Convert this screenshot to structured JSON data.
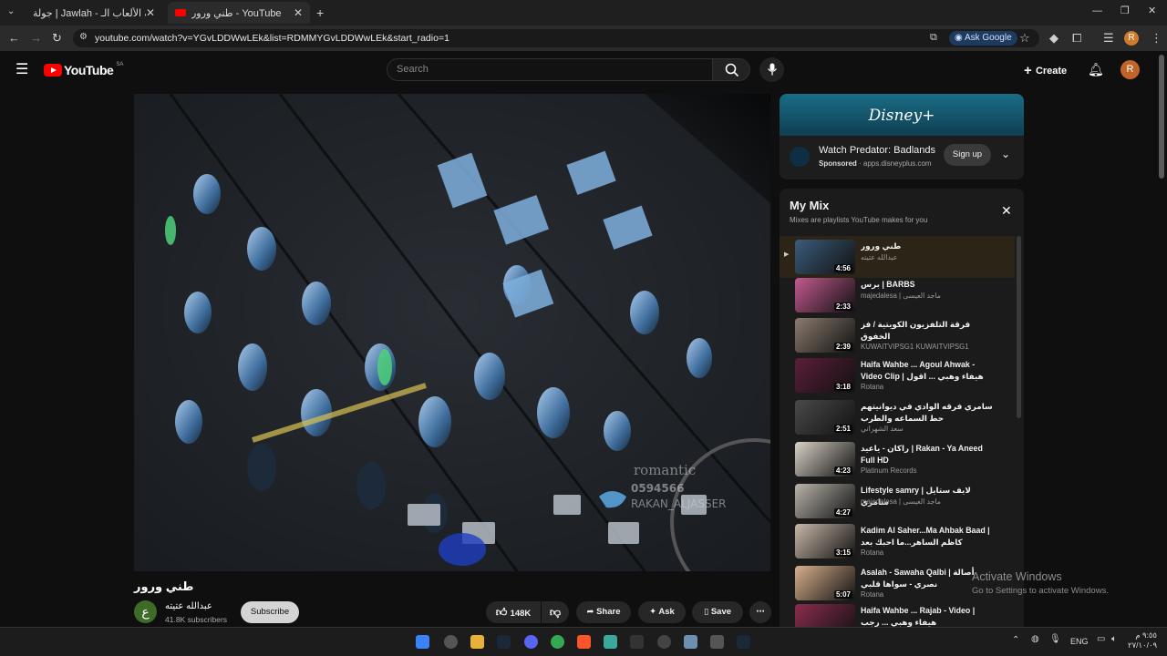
{
  "browser": {
    "tabs": [
      {
        "label": "جولة | Jawlah - منصة الألعاب الـ..."
      },
      {
        "label": "طني ورور - YouTube"
      }
    ],
    "url": "youtube.com/watch?v=YGvLDDWwLEk&list=RDMMYGvLDDWwLEk&start_radio=1",
    "ask_google": "Ask Google",
    "profile_initial": "R"
  },
  "youtube": {
    "logo_text": "YouTube",
    "country_code": "SA",
    "search_placeholder": "Search",
    "create_label": "Create",
    "avatar_initial": "R"
  },
  "video": {
    "overlay_lines": [
      "romantic",
      "0594566",
      "RAKAN_ALJASSER"
    ],
    "title": "طني ورور",
    "channel_initial": "ع",
    "channel_name": "عبدالله عتيته",
    "subscribers": "41.8K subscribers",
    "subscribe_label": "Subscribe",
    "likes": "148K",
    "share_label": "Share",
    "ask_label": "Ask",
    "save_label": "Save"
  },
  "ad": {
    "brand": "Disney+",
    "title": "Watch Predator: Badlands",
    "sponsored": "Sponsored",
    "domain": "apps.disneyplus.com",
    "cta": "Sign up"
  },
  "mix": {
    "title": "My Mix",
    "subtitle": "Mixes are playlists YouTube makes for you",
    "items": [
      {
        "title": "طني ورور",
        "channel": "عبدالله عتيته",
        "duration": "4:56",
        "thumb": "#3b5c7a"
      },
      {
        "title": "برس | BARBS",
        "channel": "majedalesa | ماجد العيسى",
        "duration": "2:33",
        "thumb": "#c25a8e"
      },
      {
        "title": "فرقة التلفزيون الكويتية / فز الخفوق",
        "channel": "KUWAITVIPSG1 KUWAITVIPSG1",
        "duration": "2:39",
        "thumb": "#8a7b6e"
      },
      {
        "title": "Haifa Wahbe ... Agoul Ahwak - Video Clip | هيفاء وهبي ... اقول اهواك",
        "channel": "Rotana",
        "duration": "3:18",
        "thumb": "#5c1e3a"
      },
      {
        "title": "سامري فرقه الوادي في ديوانيتهم حط السماعه والطرب",
        "channel": "سعد الشهراني",
        "duration": "2:51",
        "thumb": "#4a4a4a"
      },
      {
        "title": "راكان - ياعيد | Rakan - Ya Aneed Full HD",
        "channel": "Platinum Records",
        "duration": "4:23",
        "thumb": "#d9d2c6"
      },
      {
        "title": "Lifestyle samry | لايف ستايل سامري",
        "channel": "majedalesa | ماجد العيسى",
        "duration": "4:27",
        "thumb": "#b9b4ab"
      },
      {
        "title": "Kadim Al Saher...Ma Ahbak Baad | كاظم الساهر...ما احبك بعد",
        "channel": "Rotana",
        "duration": "3:15",
        "thumb": "#c8b8a8"
      },
      {
        "title": "Asalah - Sawaha Qalbi | أصالة نصري - سواها قلبي",
        "channel": "Rotana",
        "duration": "5:07",
        "thumb": "#d7b08c"
      },
      {
        "title": "Haifa Wahbe ... Rajab - Video | هيفاء وهبي ... رجب",
        "channel": "",
        "duration": "",
        "thumb": "#8b2c4f"
      }
    ]
  },
  "windows": {
    "activate_title": "Activate Windows",
    "activate_sub": "Go to Settings to activate Windows.",
    "lang": "ENG",
    "time": "٩:٥٥ م",
    "date": "٢٧/١٠/٠٩"
  }
}
